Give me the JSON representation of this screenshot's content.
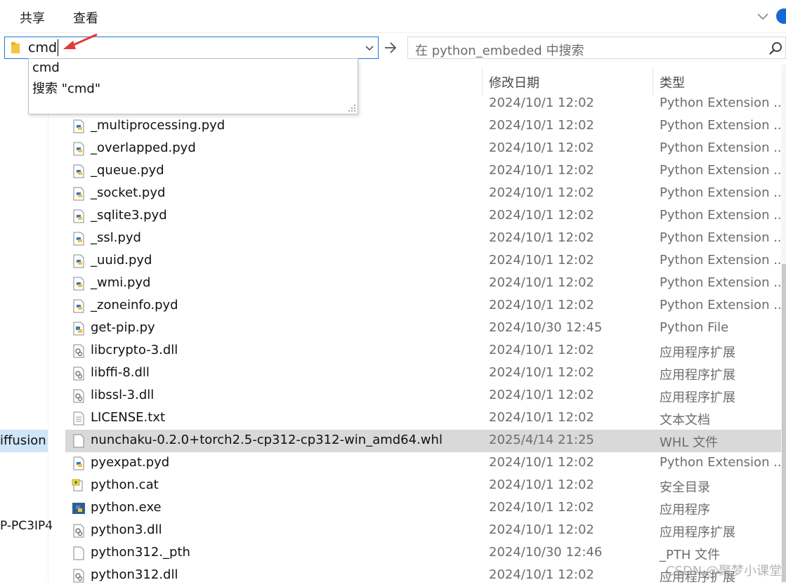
{
  "ribbon": {
    "tabs": [
      "共享",
      "查看"
    ]
  },
  "address": {
    "value": "cmd",
    "suggestions": [
      "cmd",
      "搜索 \"cmd\""
    ]
  },
  "search": {
    "placeholder": "在 python_embeded 中搜索"
  },
  "columns": {
    "date": "修改日期",
    "type": "类型"
  },
  "nav": {
    "items": [
      "iffusion",
      "P-PC3IP4"
    ]
  },
  "files": [
    {
      "name": "",
      "date": "2024/10/1 12:02",
      "type": "Python Extension ...",
      "icon": "python-icon"
    },
    {
      "name": "_multiprocessing.pyd",
      "date": "2024/10/1 12:02",
      "type": "Python Extension ...",
      "icon": "python-icon"
    },
    {
      "name": "_overlapped.pyd",
      "date": "2024/10/1 12:02",
      "type": "Python Extension ...",
      "icon": "python-icon"
    },
    {
      "name": "_queue.pyd",
      "date": "2024/10/1 12:02",
      "type": "Python Extension ...",
      "icon": "python-icon"
    },
    {
      "name": "_socket.pyd",
      "date": "2024/10/1 12:02",
      "type": "Python Extension ...",
      "icon": "python-icon"
    },
    {
      "name": "_sqlite3.pyd",
      "date": "2024/10/1 12:02",
      "type": "Python Extension ...",
      "icon": "python-icon"
    },
    {
      "name": "_ssl.pyd",
      "date": "2024/10/1 12:02",
      "type": "Python Extension ...",
      "icon": "python-icon"
    },
    {
      "name": "_uuid.pyd",
      "date": "2024/10/1 12:02",
      "type": "Python Extension ...",
      "icon": "python-icon"
    },
    {
      "name": "_wmi.pyd",
      "date": "2024/10/1 12:02",
      "type": "Python Extension ...",
      "icon": "python-icon"
    },
    {
      "name": "_zoneinfo.pyd",
      "date": "2024/10/1 12:02",
      "type": "Python Extension ...",
      "icon": "python-icon"
    },
    {
      "name": "get-pip.py",
      "date": "2024/10/30 12:45",
      "type": "Python File",
      "icon": "python-file-icon"
    },
    {
      "name": "libcrypto-3.dll",
      "date": "2024/10/1 12:02",
      "type": "应用程序扩展",
      "icon": "dll-icon"
    },
    {
      "name": "libffi-8.dll",
      "date": "2024/10/1 12:02",
      "type": "应用程序扩展",
      "icon": "dll-icon"
    },
    {
      "name": "libssl-3.dll",
      "date": "2024/10/1 12:02",
      "type": "应用程序扩展",
      "icon": "dll-icon"
    },
    {
      "name": "LICENSE.txt",
      "date": "2024/10/1 12:02",
      "type": "文本文档",
      "icon": "text-file-icon"
    },
    {
      "name": "nunchaku-0.2.0+torch2.5-cp312-cp312-win_amd64.whl",
      "date": "2025/4/14 21:25",
      "type": "WHL 文件",
      "icon": "blank-file-icon",
      "selected": true
    },
    {
      "name": "pyexpat.pyd",
      "date": "2024/10/1 12:02",
      "type": "Python Extension ...",
      "icon": "python-icon"
    },
    {
      "name": "python.cat",
      "date": "2024/10/1 12:02",
      "type": "安全目录",
      "icon": "catalog-icon"
    },
    {
      "name": "python.exe",
      "date": "2024/10/1 12:02",
      "type": "应用程序",
      "icon": "python-exe-icon"
    },
    {
      "name": "python3.dll",
      "date": "2024/10/1 12:02",
      "type": "应用程序扩展",
      "icon": "dll-icon"
    },
    {
      "name": "python312._pth",
      "date": "2024/10/30 12:46",
      "type": "_PTH 文件",
      "icon": "blank-file-icon"
    },
    {
      "name": "python312.dll",
      "date": "2024/10/1 12:02",
      "type": "应用程序扩展",
      "icon": "dll-icon"
    }
  ],
  "watermark": "CSDN @聚梦小课堂",
  "colors": {
    "accent": "#1c79d1",
    "selected_row": "#d9d9d9",
    "nav_selected": "#cfe5f8",
    "arrow": "#e53935"
  }
}
